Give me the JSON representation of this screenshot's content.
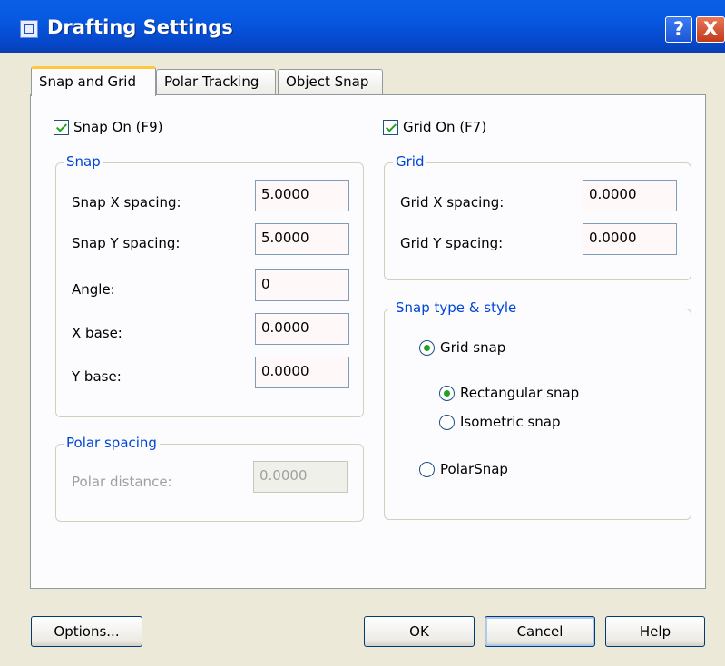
{
  "window": {
    "title": "Drafting Settings",
    "help_glyph": "?",
    "close_glyph": "X",
    "title_icon": "drafting-settings-icon"
  },
  "tabs": [
    {
      "label": "Snap and Grid",
      "active": true
    },
    {
      "label": "Polar Tracking",
      "active": false
    },
    {
      "label": "Object Snap",
      "active": false
    }
  ],
  "snap_on": {
    "label": "Snap On (F9)",
    "checked": true
  },
  "grid_on": {
    "label": "Grid On (F7)",
    "checked": true
  },
  "snap": {
    "legend": "Snap",
    "fields": [
      {
        "label": "Snap X spacing:",
        "value": "5.0000"
      },
      {
        "label": "Snap Y spacing:",
        "value": "5.0000"
      },
      {
        "label": "Angle:",
        "value": "0"
      },
      {
        "label": "X base:",
        "value": "0.0000"
      },
      {
        "label": "Y base:",
        "value": "0.0000"
      }
    ]
  },
  "polar_spacing": {
    "legend": "Polar spacing",
    "label": "Polar distance:",
    "value": "0.0000",
    "disabled": true
  },
  "grid": {
    "legend": "Grid",
    "fields": [
      {
        "label": "Grid X spacing:",
        "value": "0.0000"
      },
      {
        "label": "Grid Y spacing:",
        "value": "0.0000"
      }
    ]
  },
  "snap_type": {
    "legend": "Snap type & style",
    "grid_snap": {
      "label": "Grid snap",
      "selected": true
    },
    "rectangular_snap": {
      "label": "Rectangular snap",
      "selected": true
    },
    "isometric_snap": {
      "label": "Isometric snap",
      "selected": false
    },
    "polar_snap": {
      "label": "PolarSnap",
      "selected": false
    }
  },
  "buttons": {
    "options": "Options...",
    "ok": "OK",
    "cancel": "Cancel",
    "help": "Help"
  },
  "colors": {
    "title_bar": "#0758e0",
    "dialog_bg": "#ece9d8",
    "group_legend": "#0046d5",
    "check_mark": "#21a121",
    "active_tab_accent": "#ffc83c"
  }
}
